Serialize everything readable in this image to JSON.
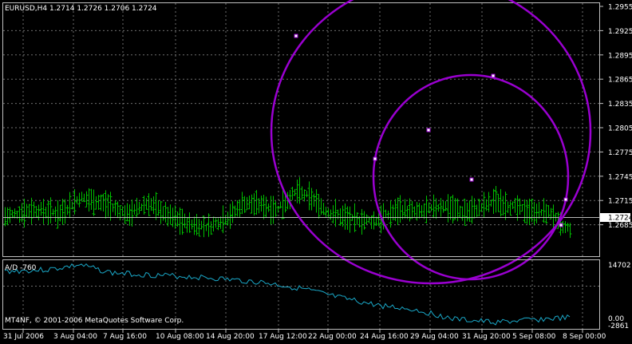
{
  "main": {
    "header": "EURUSD,H4  1.2714 1.2726 1.2706 1.2724",
    "price_labels": [
      "1.2955",
      "1.2925",
      "1.2895",
      "1.2865",
      "1.2835",
      "1.2805",
      "1.2775",
      "1.2745",
      "1.2715",
      "1.2685"
    ],
    "current_price": "1.2724",
    "bar_color": "#00c000",
    "circle_color": "#9a00d0"
  },
  "indicator": {
    "label": "A/D -760",
    "scale_top": "14702",
    "scale_zero": "0.00",
    "scale_bottom": "-2861",
    "line_color": "#1aa8c8"
  },
  "footer": {
    "copyright": "MT4NF, © 2001-2006 MetaQuotes Software Corp."
  },
  "time_axis": {
    "labels": [
      "31 Jul 2006",
      "3 Aug 04:00",
      "7 Aug 16:00",
      "10 Aug 08:00",
      "14 Aug 20:00",
      "17 Aug 12:00",
      "22 Aug 00:00",
      "24 Aug 16:00",
      "29 Aug 04:00",
      "31 Aug 20:00",
      "5 Sep 08:00",
      "8 Sep 00:00"
    ]
  }
}
